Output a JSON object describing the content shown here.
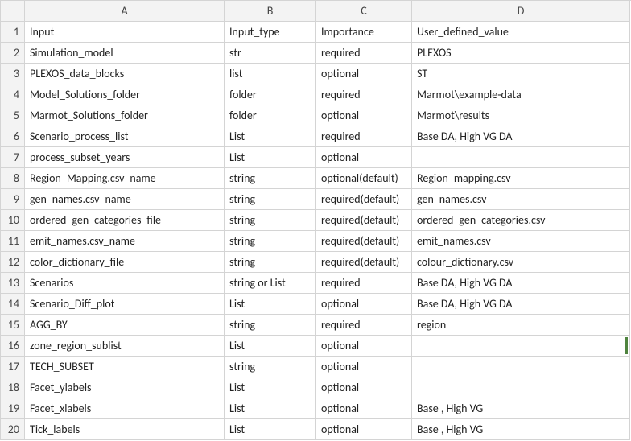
{
  "columns": [
    "A",
    "B",
    "C",
    "D"
  ],
  "rowCount": 20,
  "selectedRow": 16,
  "headers": {
    "a": "Input",
    "b": "Input_type",
    "c": "Importance",
    "d": "User_defined_value"
  },
  "rows": [
    {
      "a": "Input",
      "b": "Input_type",
      "c": "Importance",
      "d": "User_defined_value"
    },
    {
      "a": "Simulation_model",
      "b": "str",
      "c": "required",
      "d": "PLEXOS"
    },
    {
      "a": "PLEXOS_data_blocks",
      "b": "list",
      "c": "optional",
      "d": "ST"
    },
    {
      "a": "Model_Solutions_folder",
      "b": "folder",
      "c": "required",
      "d": "Marmot\\example-data"
    },
    {
      "a": "Marmot_Solutions_folder",
      "b": "folder",
      "c": "optional",
      "d": "Marmot\\results"
    },
    {
      "a": "Scenario_process_list",
      "b": "List",
      "c": "required",
      "d": "Base DA, High VG DA"
    },
    {
      "a": "process_subset_years",
      "b": "List",
      "c": "optional",
      "d": ""
    },
    {
      "a": "Region_Mapping.csv_name",
      "b": "string",
      "c": "optional(default)",
      "d": "Region_mapping.csv"
    },
    {
      "a": "gen_names.csv_name",
      "b": "string",
      "c": "required(default)",
      "d": "gen_names.csv"
    },
    {
      "a": "ordered_gen_categories_file",
      "b": "string",
      "c": "required(default)",
      "d": "ordered_gen_categories.csv"
    },
    {
      "a": "emit_names.csv_name",
      "b": "string",
      "c": "required(default)",
      "d": "emit_names.csv"
    },
    {
      "a": "color_dictionary_file",
      "b": "string",
      "c": "required(default)",
      "d": "colour_dictionary.csv"
    },
    {
      "a": "Scenarios",
      "b": "string or List",
      "c": "required",
      "d": "Base DA, High VG DA"
    },
    {
      "a": "Scenario_Diff_plot",
      "b": "List",
      "c": "optional",
      "d": "Base DA, High VG DA"
    },
    {
      "a": "AGG_BY",
      "b": "string",
      "c": "required",
      "d": "region"
    },
    {
      "a": "zone_region_sublist",
      "b": "List",
      "c": "optional",
      "d": ""
    },
    {
      "a": "TECH_SUBSET",
      "b": "string",
      "c": "optional",
      "d": ""
    },
    {
      "a": "Facet_ylabels",
      "b": "List",
      "c": "optional",
      "d": ""
    },
    {
      "a": "Facet_xlabels",
      "b": "List",
      "c": "optional",
      "d": "Base , High VG"
    },
    {
      "a": "Tick_labels",
      "b": "List",
      "c": "optional",
      "d": "Base , High VG"
    }
  ]
}
